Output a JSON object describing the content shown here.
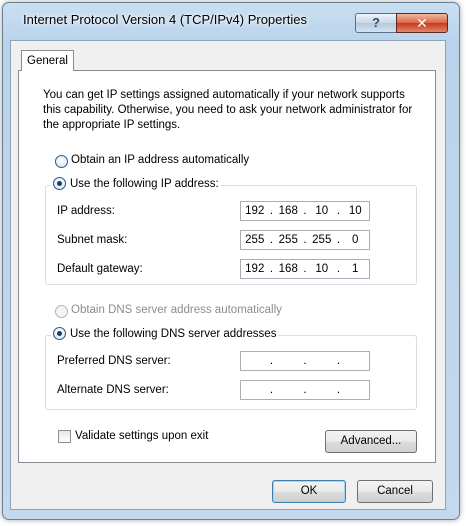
{
  "window": {
    "title": "Internet Protocol Version 4 (TCP/IPv4) Properties",
    "help_glyph": "?",
    "close_glyph": "✕"
  },
  "tabs": [
    {
      "label": "General",
      "selected": true
    }
  ],
  "description": "You can get IP settings assigned automatically if your network supports this capability. Otherwise, you need to ask your network administrator for the appropriate IP settings.",
  "ip_section": {
    "auto_label": "Obtain an IP address automatically",
    "auto_checked": false,
    "manual_label": "Use the following IP address:",
    "manual_checked": true,
    "fields": [
      {
        "label": "IP address:",
        "octets": [
          "192",
          "168",
          "10",
          "10"
        ]
      },
      {
        "label": "Subnet mask:",
        "octets": [
          "255",
          "255",
          "255",
          "0"
        ]
      },
      {
        "label": "Default gateway:",
        "octets": [
          "192",
          "168",
          "10",
          "1"
        ]
      }
    ]
  },
  "dns_section": {
    "auto_label": "Obtain DNS server address automatically",
    "auto_checked": false,
    "auto_disabled": true,
    "manual_label": "Use the following DNS server addresses",
    "manual_checked": true,
    "fields": [
      {
        "label": "Preferred DNS server:",
        "octets": [
          "",
          "",
          "",
          ""
        ]
      },
      {
        "label": "Alternate DNS server:",
        "octets": [
          "",
          "",
          "",
          ""
        ]
      }
    ]
  },
  "validate": {
    "label": "Validate settings upon exit",
    "checked": false
  },
  "buttons": {
    "advanced": "Advanced...",
    "ok": "OK",
    "cancel": "Cancel"
  },
  "colors": {
    "accent": "#3c7fb1",
    "close_button": "#c7391d",
    "frame": "#b9d3ec"
  }
}
